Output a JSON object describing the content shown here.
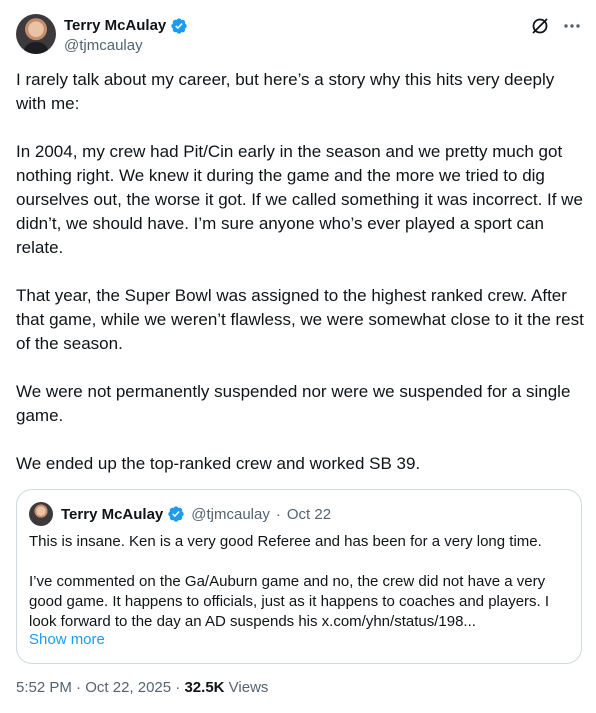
{
  "author": {
    "name": "Terry McAulay",
    "handle": "@tjmcaulay"
  },
  "post": {
    "paragraphs": [
      "I rarely talk about my career, but here’s a story why this hits very deeply with me:",
      "In 2004, my crew had Pit/Cin early in the season and we pretty much got nothing right. We knew it during the game and the more we tried to dig ourselves out, the worse it got. If we called something it was incorrect. If we didn’t, we should have. I’m sure anyone who’s ever played a sport can relate.",
      "That year, the Super Bowl was assigned to the highest ranked crew. After that game, while we weren’t flawless, we were somewhat close to it the rest of the season.",
      "We were not permanently suspended nor were we suspended for a single game.",
      "We ended up the top-ranked crew and worked SB 39."
    ]
  },
  "quote": {
    "name": "Terry McAulay",
    "handle": "@tjmcaulay",
    "separator": "·",
    "date": "Oct 22",
    "line1": "This is insane. Ken is a very good Referee and has been for a very long time.",
    "line2": "I’ve commented on the Ga/Auburn game and no, the crew did not have a very good game. It happens to officials, just as it happens to coaches and players. I look forward to the day an AD suspends his x.com/yhn/status/198...",
    "show_more": "Show more"
  },
  "footer": {
    "time": "5:52 PM",
    "sep1": "·",
    "date": "Oct 22, 2025",
    "sep2": "·",
    "views_count": "32.5K",
    "views_label": "Views"
  },
  "icons": {
    "verified": "verified-badge-icon",
    "grok": "grok-icon",
    "more": "more-icon"
  },
  "colors": {
    "accent": "#1d9bf0",
    "secondary_text": "#536471",
    "border": "#cfd9de"
  }
}
